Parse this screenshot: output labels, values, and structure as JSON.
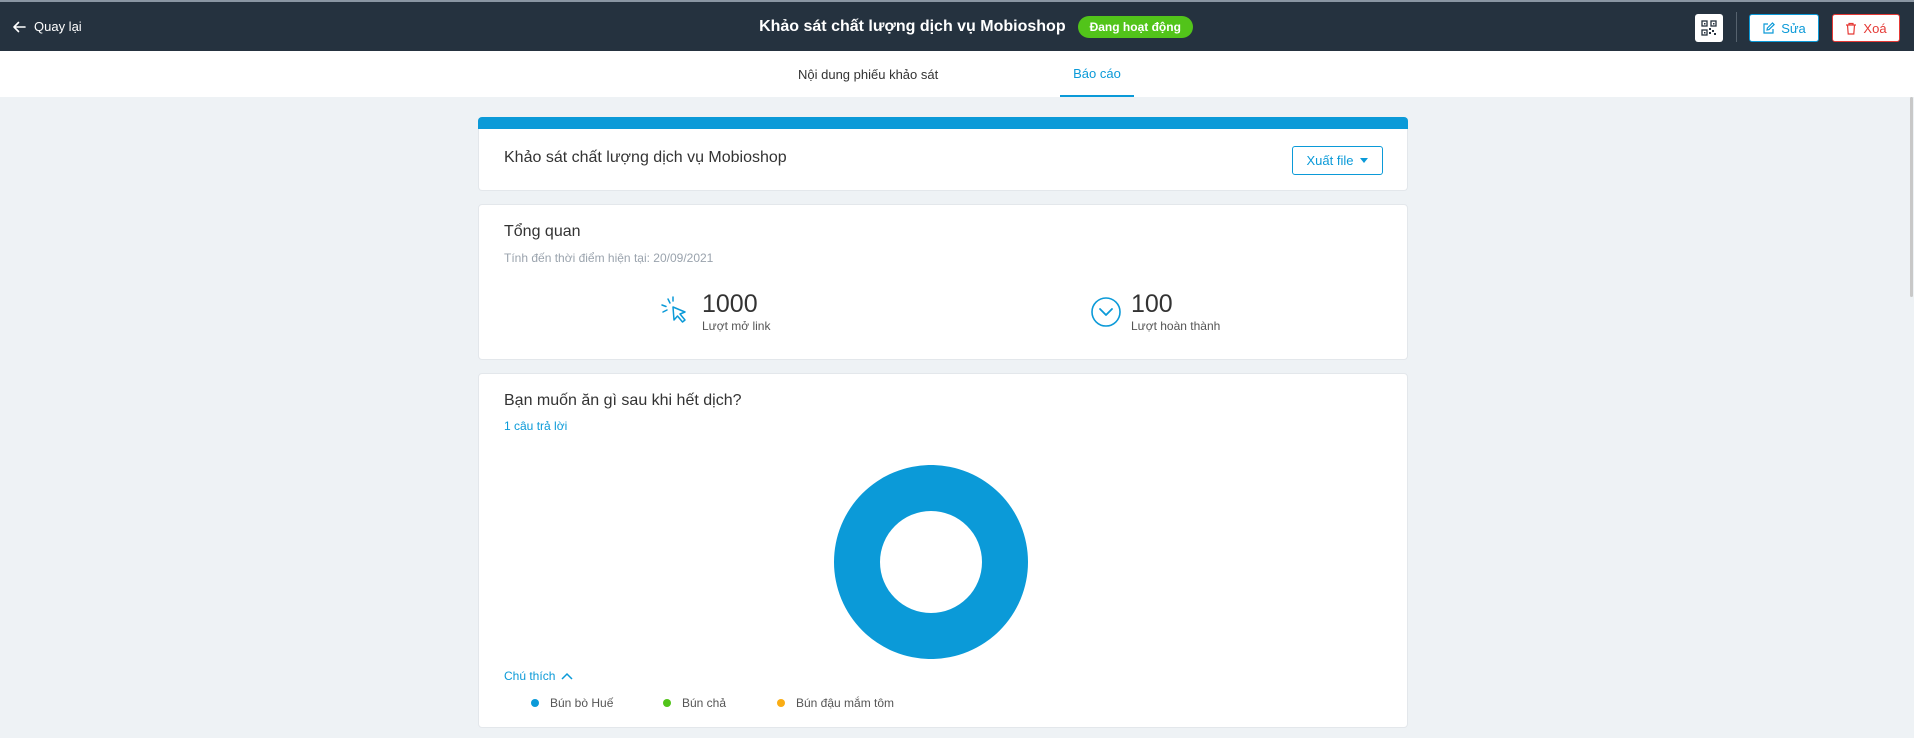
{
  "header": {
    "back_label": "Quay lại",
    "title": "Khảo sát chất lượng dịch vụ Mobioshop",
    "status_badge": "Đang hoạt động",
    "edit_label": "Sửa",
    "delete_label": "Xoá"
  },
  "tabs": [
    {
      "label": "Nội dung phiếu khảo sát",
      "active": false
    },
    {
      "label": "Báo cáo",
      "active": true
    }
  ],
  "report": {
    "survey_title": "Khảo sát chất lượng dịch vụ Mobioshop",
    "export_label": "Xuất file"
  },
  "overview": {
    "title": "Tổng quan",
    "as_of": "Tính đến thời điểm hiện tại: 20/09/2021",
    "link_opens": {
      "value": "1000",
      "label": "Lượt mở link"
    },
    "completions": {
      "value": "100",
      "label": "Lượt hoàn thành"
    }
  },
  "question": {
    "title": "Bạn muốn ăn gì sau khi hết dịch?",
    "answers_count": "1 câu trả lời",
    "legend_toggle": "Chú thích",
    "legend": [
      {
        "label": "Bún bò Huế",
        "color": "#0b9ad8"
      },
      {
        "label": "Bún chả",
        "color": "#52c41a"
      },
      {
        "label": "Bún đậu mắm tôm",
        "color": "#faad14"
      }
    ]
  },
  "chart_data": {
    "type": "pie",
    "categories": [
      "Bún bò Huế",
      "Bún chả",
      "Bún đậu mắm tôm"
    ],
    "values": [
      1,
      0,
      0
    ],
    "colors": [
      "#0b9ad8",
      "#52c41a",
      "#faad14"
    ]
  },
  "colors": {
    "accent": "#0b9ad8",
    "header_bg": "#25323f",
    "status_green": "#52c41a",
    "danger": "#e53935"
  }
}
